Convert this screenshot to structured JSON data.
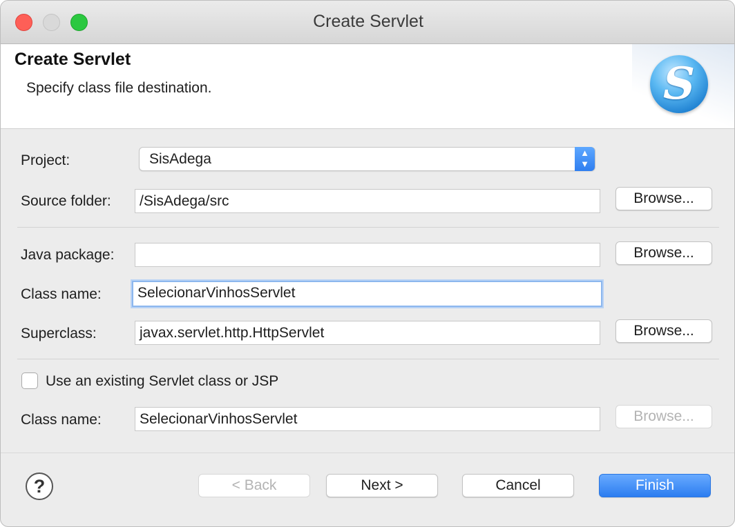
{
  "window": {
    "title": "Create Servlet"
  },
  "banner": {
    "title": "Create Servlet",
    "description": "Specify class file destination.",
    "logo_letter": "S"
  },
  "form": {
    "project_label": "Project:",
    "project_value": "SisAdega",
    "source_folder_label": "Source folder:",
    "source_folder_value": "/SisAdega/src",
    "java_package_label": "Java package:",
    "java_package_value": "",
    "class_name_label": "Class name:",
    "class_name_value": "SelecionarVinhosServlet",
    "superclass_label": "Superclass:",
    "superclass_value": "javax.servlet.http.HttpServlet",
    "use_existing_label": "Use an existing Servlet class or JSP",
    "use_existing_checked": false,
    "existing_class_label": "Class name:",
    "existing_class_value": "SelecionarVinhosServlet",
    "browse_label": "Browse..."
  },
  "footer": {
    "back_label": "< Back",
    "next_label": "Next >",
    "cancel_label": "Cancel",
    "finish_label": "Finish",
    "help_symbol": "?"
  },
  "colors": {
    "accent": "#2c7df0",
    "focus_ring": "#8cb7ee"
  },
  "icons": [
    "close-window-icon",
    "minimize-window-icon",
    "zoom-window-icon",
    "servlet-logo-icon",
    "select-arrows-icon",
    "help-icon"
  ]
}
